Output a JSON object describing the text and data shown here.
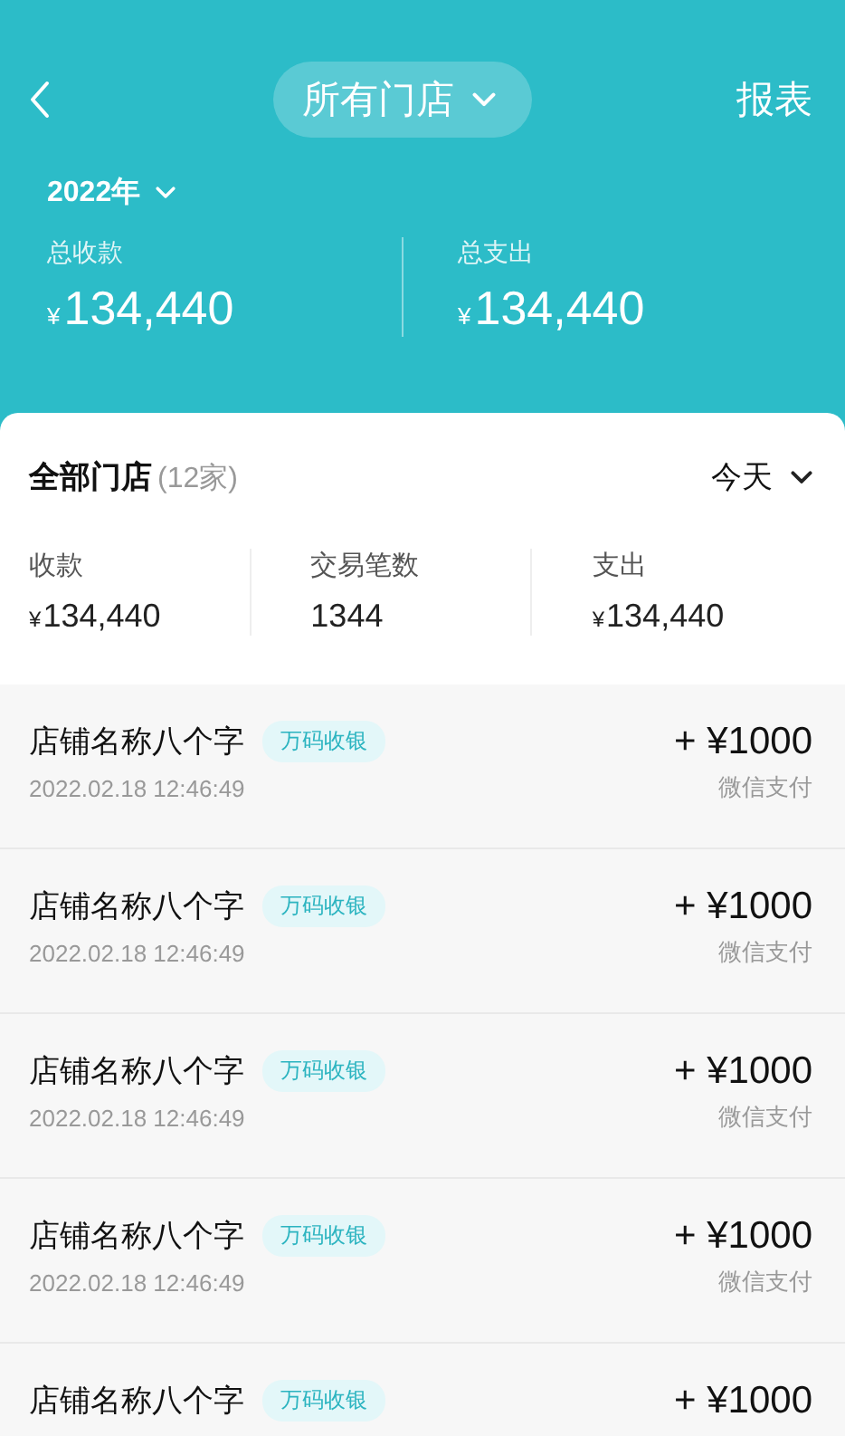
{
  "header": {
    "title": "所有门店",
    "report": "报表",
    "year": "2022年",
    "totals": [
      {
        "label": "总收款",
        "currency": "¥",
        "amount": "134,440"
      },
      {
        "label": "总支出",
        "currency": "¥",
        "amount": "134,440"
      }
    ]
  },
  "summary": {
    "title": "全部门店",
    "count": "(12家)",
    "period": "今天",
    "stats": [
      {
        "label": "收款",
        "currency": "¥",
        "value": "134,440"
      },
      {
        "label": "交易笔数",
        "value": "1344"
      },
      {
        "label": "支出",
        "currency": "¥",
        "value": "134,440"
      }
    ]
  },
  "transactions": [
    {
      "store": "店铺名称八个字",
      "tag": "万码收银",
      "time": "2022.02.18 12:46:49",
      "amount": "+ ¥1000",
      "method": "微信支付"
    },
    {
      "store": "店铺名称八个字",
      "tag": "万码收银",
      "time": "2022.02.18 12:46:49",
      "amount": "+ ¥1000",
      "method": "微信支付"
    },
    {
      "store": "店铺名称八个字",
      "tag": "万码收银",
      "time": "2022.02.18 12:46:49",
      "amount": "+ ¥1000",
      "method": "微信支付"
    },
    {
      "store": "店铺名称八个字",
      "tag": "万码收银",
      "time": "2022.02.18 12:46:49",
      "amount": "+ ¥1000",
      "method": "微信支付"
    },
    {
      "store": "店铺名称八个字",
      "tag": "万码收银",
      "amount": "+ ¥1000"
    }
  ]
}
